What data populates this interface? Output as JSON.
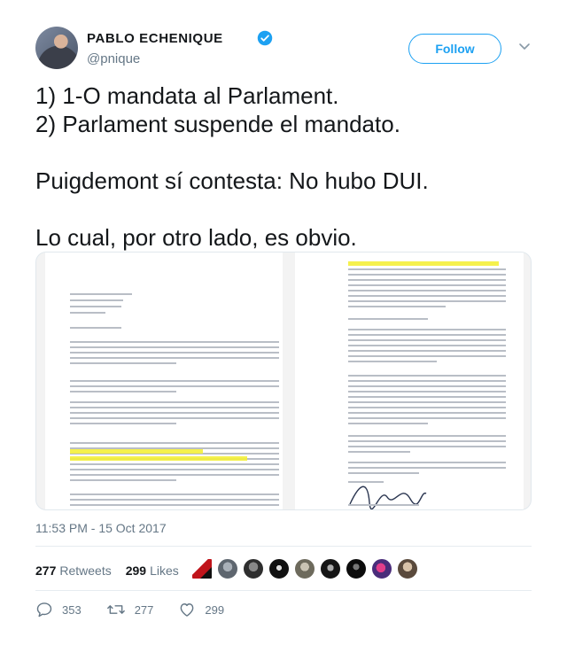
{
  "author": {
    "name": "PABLO ECHENIQUE",
    "handle": "@pnique",
    "verified": true
  },
  "follow_button": {
    "label": "Follow"
  },
  "tweet": {
    "lines": [
      "1) 1-O mandata al Parlament.",
      "2) Parlament suspende el mandato.",
      "",
      "Puigdemont sí contesta: No hubo DUI.",
      "",
      "Lo cual, por otro lado, es obvio."
    ]
  },
  "timestamp": "11:53 PM - 15 Oct 2017",
  "stats": {
    "retweets_count": "277",
    "retweets_label": "Retweets",
    "likes_count": "299",
    "likes_label": "Likes"
  },
  "actions": {
    "reply_count": "353",
    "retweet_count": "277",
    "like_count": "299"
  },
  "colors": {
    "accent": "#1da1f2",
    "text": "#14171a",
    "muted": "#657786",
    "highlight": "#f4ef3a"
  },
  "icons": [
    "verified-badge-icon",
    "chevron-down-icon",
    "reply-icon",
    "retweet-icon",
    "like-icon"
  ]
}
